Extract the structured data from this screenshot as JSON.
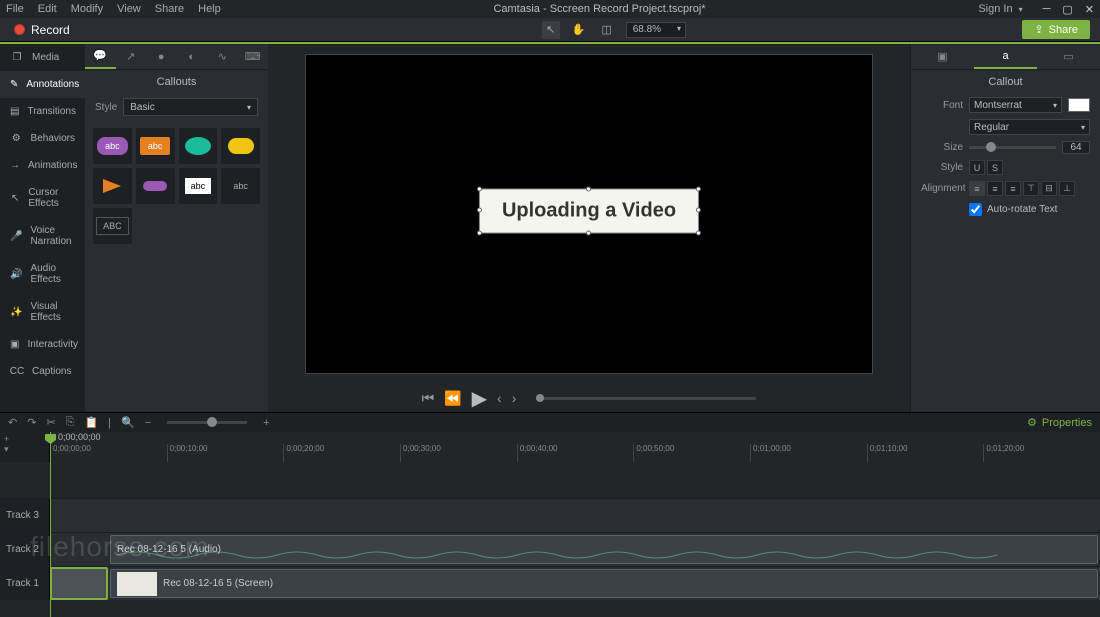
{
  "menubar": [
    "File",
    "Edit",
    "Modify",
    "View",
    "Share",
    "Help"
  ],
  "window_title": "Camtasia - Sccreen Record Project.tscproj*",
  "signin": "Sign In",
  "record_label": "Record",
  "zoom": "68.8%",
  "share_label": "Share",
  "sidebar": {
    "items": [
      {
        "label": "Media",
        "icon": "❐"
      },
      {
        "label": "Annotations",
        "icon": "✎"
      },
      {
        "label": "Transitions",
        "icon": "▤"
      },
      {
        "label": "Behaviors",
        "icon": "⚙"
      },
      {
        "label": "Animations",
        "icon": "→"
      },
      {
        "label": "Cursor Effects",
        "icon": "↖"
      },
      {
        "label": "Voice Narration",
        "icon": "🎤"
      },
      {
        "label": "Audio Effects",
        "icon": "🔊"
      },
      {
        "label": "Visual Effects",
        "icon": "✨"
      },
      {
        "label": "Interactivity",
        "icon": "▣"
      },
      {
        "label": "Captions",
        "icon": "CC"
      }
    ]
  },
  "panel": {
    "title": "Callouts",
    "style_label": "Style",
    "style_value": "Basic"
  },
  "canvas": {
    "callout_text": "Uploading a Video"
  },
  "props": {
    "title": "Callout",
    "font_label": "Font",
    "font_value": "Montserrat",
    "weight_value": "Regular",
    "size_label": "Size",
    "size_value": "64",
    "style_label": "Style",
    "align_label": "Alignment",
    "autorotate": "Auto-rotate Text"
  },
  "properties_btn": "Properties",
  "timeline": {
    "pos": "0;00;00;00",
    "ticks": [
      "0;00;00;00",
      "0;00;10;00",
      "0;00;20;00",
      "0;00;30;00",
      "0;00;40;00",
      "0;00;50;00",
      "0;01;00;00",
      "0;01;10;00",
      "0;01;20;00"
    ],
    "tracks": [
      "Track 3",
      "Track 2",
      "Track 1"
    ],
    "clip_audio": "Rec 08-12-16 5 (Audio)",
    "clip_screen": "Rec 08-12-16 5 (Screen)"
  },
  "watermark": "filehorse.com"
}
